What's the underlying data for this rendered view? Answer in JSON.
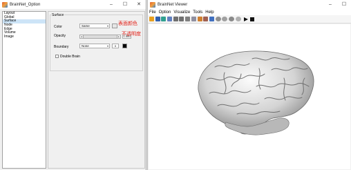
{
  "option_window": {
    "title": "BrainNet_Option",
    "controls": [
      "–",
      "☐",
      "✕"
    ],
    "tree": [
      "Layout",
      "Global",
      "Surface",
      "Node",
      "Edge",
      "Volume",
      "Image"
    ],
    "selected_tree_item": "Surface",
    "surface_group": {
      "title": "Surface",
      "color_label": "Color",
      "color_value": "Same",
      "color_note": "表面颜色",
      "opacity_label": "Opacity",
      "opacity_value": "1.000",
      "opacity_note": "不透明度",
      "boundary_label": "Boundary",
      "boundary_value": "None",
      "boundary_number": "0",
      "double_brain_label": "Double Brain"
    }
  },
  "viewer_window": {
    "title": "BrainNet Viewer",
    "controls": [
      "–",
      "☐"
    ],
    "menu": [
      "File",
      "Option",
      "Visualize",
      "Tools",
      "Help"
    ],
    "toolbar_icons": [
      {
        "name": "open-folder-icon",
        "color": "#e8a020"
      },
      {
        "name": "save-icon",
        "color": "#3060b0"
      },
      {
        "name": "layers-icon",
        "color": "#30a090"
      },
      {
        "name": "grid-icon",
        "color": "#6080c0"
      },
      {
        "name": "zoom-in-icon",
        "color": "#707070"
      },
      {
        "name": "zoom-out-icon",
        "color": "#707070"
      },
      {
        "name": "pan-hand-icon",
        "color": "#808080"
      },
      {
        "name": "rotate-icon",
        "color": "#9090a0"
      },
      {
        "name": "data-cursor-icon",
        "color": "#d08030"
      },
      {
        "name": "brush-icon",
        "color": "#a06050"
      },
      {
        "name": "colorbar-icon",
        "color": "#4070c0"
      },
      {
        "name": "brain-view-1-icon",
        "color": "#909090"
      },
      {
        "name": "brain-view-2-icon",
        "color": "#a0a0a0"
      },
      {
        "name": "brain-view-3-icon",
        "color": "#8a8a8a"
      },
      {
        "name": "brain-view-4-icon",
        "color": "#b0b0b0"
      },
      {
        "name": "play-icon",
        "color": "#111111"
      },
      {
        "name": "stop-icon",
        "color": "#111111"
      }
    ]
  },
  "colors": {
    "annotation_red": "#e2231a",
    "selection_blue": "#cde4f7"
  }
}
